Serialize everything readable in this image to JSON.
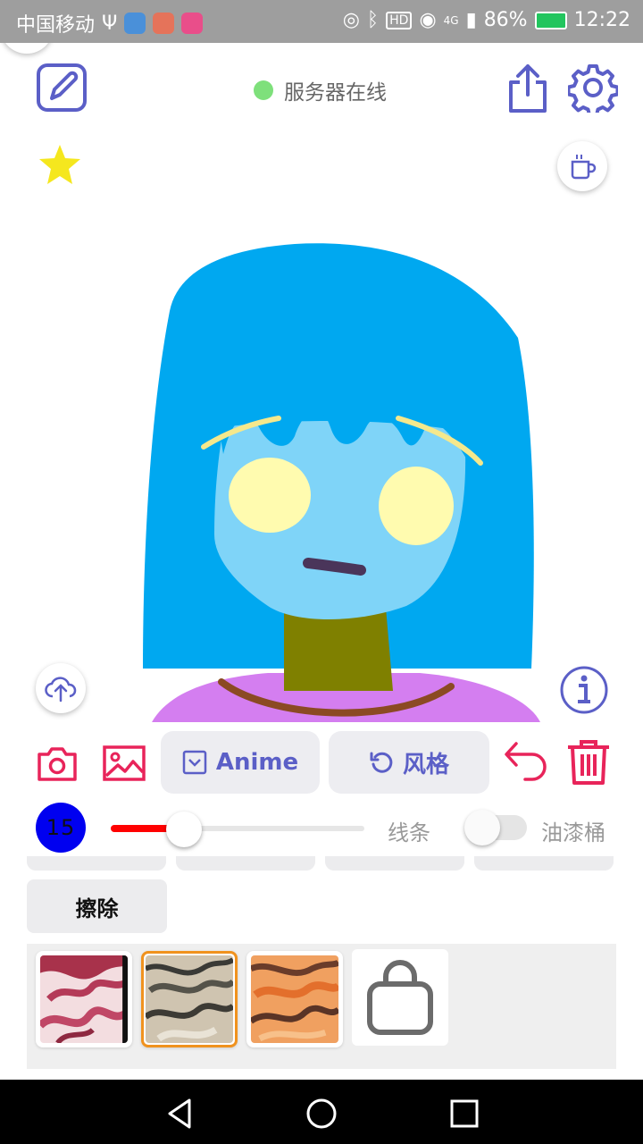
{
  "status_bar": {
    "carrier": "中国移动",
    "network": "4G",
    "battery": "86%",
    "time": "12:22"
  },
  "header": {
    "server_status": "服务器在线",
    "server_status_color": "#7ee07b"
  },
  "toolbar": {
    "anime_label": "Anime",
    "style_label": "风格"
  },
  "brush": {
    "size": "15",
    "size_fraction": 0.29,
    "line_label": "线条",
    "bucket_label": "油漆桶",
    "bucket_enabled": false
  },
  "actions": {
    "erase_label": "擦除"
  },
  "styles": {
    "items": [
      "style-red",
      "style-gray",
      "style-orange"
    ],
    "selected_index": 1
  },
  "colors": {
    "accent": "#5b5fc7",
    "danger": "#e8245a",
    "star": "#f5e71e",
    "brush": "#0000f0",
    "slider_fill": "#ff0000",
    "selected_border": "#f0921e"
  },
  "icons": {
    "edit": "edit-icon",
    "user": "user-icon",
    "share": "share-icon",
    "settings": "gear-icon",
    "favorite": "star-icon",
    "coffee": "coffee-cup-icon",
    "upload": "cloud-upload-icon",
    "info": "info-icon",
    "camera": "camera-icon",
    "gallery": "image-icon",
    "undo": "undo-icon",
    "delete": "trash-icon",
    "shop": "shopping-bag-icon"
  }
}
